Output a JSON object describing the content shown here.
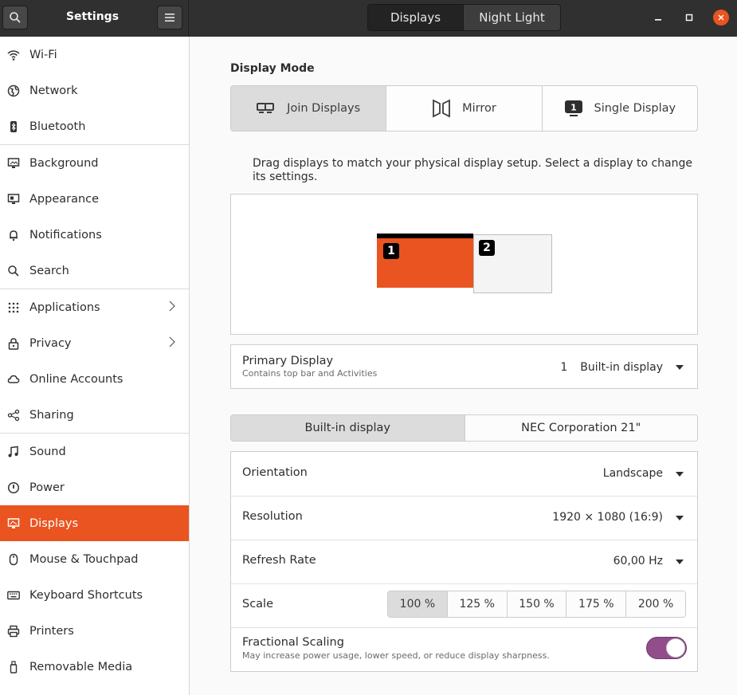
{
  "header": {
    "title": "Settings",
    "tabs": [
      "Displays",
      "Night Light"
    ]
  },
  "sidebar": {
    "items": [
      {
        "label": "Wi-Fi",
        "icon": "wifi-icon"
      },
      {
        "label": "Network",
        "icon": "network-icon"
      },
      {
        "label": "Bluetooth",
        "icon": "bluetooth-icon"
      },
      {
        "label": "Background",
        "icon": "background-icon"
      },
      {
        "label": "Appearance",
        "icon": "appearance-icon"
      },
      {
        "label": "Notifications",
        "icon": "bell-icon"
      },
      {
        "label": "Search",
        "icon": "search-icon"
      },
      {
        "label": "Applications",
        "icon": "apps-grid-icon"
      },
      {
        "label": "Privacy",
        "icon": "lock-icon"
      },
      {
        "label": "Online Accounts",
        "icon": "cloud-icon"
      },
      {
        "label": "Sharing",
        "icon": "share-icon"
      },
      {
        "label": "Sound",
        "icon": "music-note-icon"
      },
      {
        "label": "Power",
        "icon": "power-icon"
      },
      {
        "label": "Displays",
        "icon": "display-icon"
      },
      {
        "label": "Mouse & Touchpad",
        "icon": "mouse-icon"
      },
      {
        "label": "Keyboard Shortcuts",
        "icon": "keyboard-icon"
      },
      {
        "label": "Printers",
        "icon": "printer-icon"
      },
      {
        "label": "Removable Media",
        "icon": "usb-icon"
      }
    ],
    "active": "Displays"
  },
  "main": {
    "display_mode_heading": "Display Mode",
    "modes": [
      "Join Displays",
      "Mirror",
      "Single Display"
    ],
    "selected_mode": "Join Displays",
    "hint": "Drag displays to match your physical display setup. Select a display to change its settings.",
    "monitors": [
      "1",
      "2"
    ],
    "primary": {
      "title": "Primary Display",
      "subtitle": "Contains top bar and Activities",
      "number": "1",
      "value": "Built-in display"
    },
    "display_tabs": [
      "Built-in display",
      "NEC Corporation 21\""
    ],
    "settings": {
      "orientation_label": "Orientation",
      "orientation_value": "Landscape",
      "resolution_label": "Resolution",
      "resolution_value": "1920 × 1080 (16:9)",
      "refresh_label": "Refresh Rate",
      "refresh_value": "60,00 Hz",
      "scale_label": "Scale",
      "scale_options": [
        "100 %",
        "125 %",
        "150 %",
        "175 %",
        "200 %"
      ],
      "scale_selected": "100 %",
      "fractional_label": "Fractional Scaling",
      "fractional_sub": "May increase power usage, lower speed, or reduce display sharpness.",
      "fractional_enabled": true
    }
  },
  "colors": {
    "accent": "#e95420",
    "toggle": "#924d8b",
    "headerbar": "#303030"
  }
}
